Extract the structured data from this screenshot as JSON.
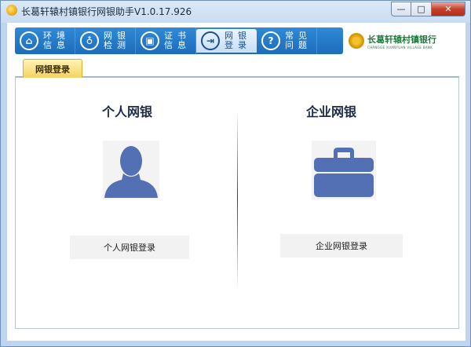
{
  "window": {
    "title": "长葛轩辕村镇银行网银助手V1.0.17.926",
    "controls": {
      "minimize": "—",
      "maximize": "□",
      "close": "✕"
    }
  },
  "toolbar": {
    "items": [
      {
        "label": "环境信息",
        "icon": "home-icon",
        "glyph": "⌂"
      },
      {
        "label": "网银检测",
        "icon": "stethoscope-icon",
        "glyph": "♁"
      },
      {
        "label": "证书信息",
        "icon": "certificate-icon",
        "glyph": "▣"
      },
      {
        "label": "网银登录",
        "icon": "login-icon",
        "glyph": "⇥"
      },
      {
        "label": "常见问题",
        "icon": "question-icon",
        "glyph": "?"
      }
    ],
    "active_index": 3
  },
  "logo": {
    "name_cn": "长葛轩辕村镇银行",
    "name_en": "CHANGGE XUANYUAN VILLAGE BANK"
  },
  "tab": {
    "label": "网银登录"
  },
  "personal": {
    "title": "个人网银",
    "icon": "person-icon",
    "button": "个人网银登录"
  },
  "corporate": {
    "title": "企业网银",
    "icon": "briefcase-icon",
    "button": "企业网银登录"
  },
  "colors": {
    "accent": "#1d6cbc",
    "icon_fill": "#5470b5",
    "tab_gold": "#f5d461"
  }
}
